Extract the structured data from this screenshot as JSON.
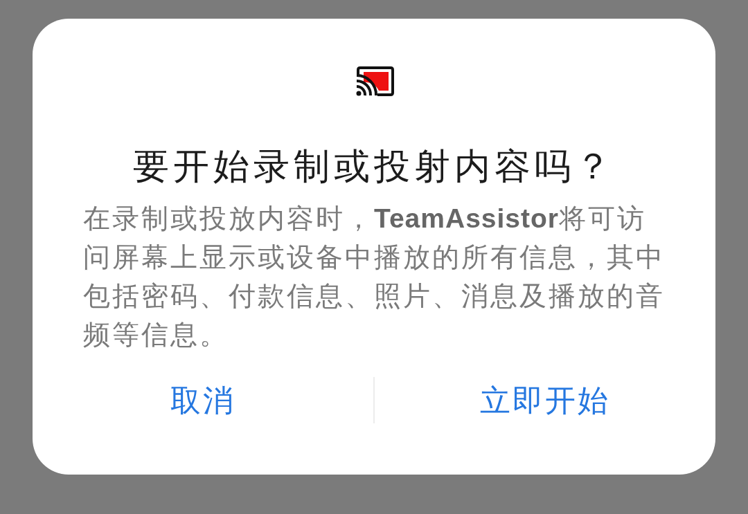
{
  "dialog": {
    "title": "要开始录制或投射内容吗？",
    "message": "在录制或投放内容时，**TeamAssistor**将可访问屏幕上显示或设备中播放的所有信息，其中包括密码、付款信息、照片、消息及播放的音频等信息。",
    "buttons": [
      {
        "label": "取消"
      },
      {
        "label": "立即开始"
      }
    ]
  }
}
